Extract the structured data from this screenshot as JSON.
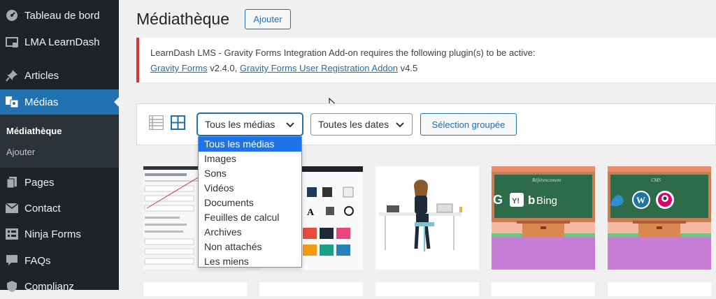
{
  "sidebar": {
    "items": [
      {
        "label": "Tableau de bord",
        "icon": "dashboard-icon"
      },
      {
        "label": "LMA LearnDash",
        "icon": "learndash-icon"
      },
      {
        "label": "Articles",
        "icon": "pin-icon"
      },
      {
        "label": "Médias",
        "icon": "media-icon"
      },
      {
        "label": "Pages",
        "icon": "pages-icon"
      },
      {
        "label": "Contact",
        "icon": "mail-icon"
      },
      {
        "label": "Ninja Forms",
        "icon": "forms-icon"
      },
      {
        "label": "FAQs",
        "icon": "faq-icon"
      },
      {
        "label": "Complianz",
        "icon": "shield-icon"
      }
    ],
    "submenu": [
      {
        "label": "Médiathèque"
      },
      {
        "label": "Ajouter"
      }
    ]
  },
  "header": {
    "title": "Médiathèque",
    "add_label": "Ajouter"
  },
  "notice": {
    "text": "LearnDash LMS - Gravity Forms Integration Add-on requires the following plugin(s) to be active:",
    "link1": "Gravity Forms",
    "ver1": " v2.4.0,",
    "link2": "Gravity Forms User Registration Addon",
    "ver2": " v4.5"
  },
  "toolbar": {
    "type_filter": "Tous les médias",
    "date_filter": "Toutes les dates",
    "bulk_label": "Sélection groupée",
    "options": [
      "Tous les médias",
      "Images",
      "Sons",
      "Vidéos",
      "Documents",
      "Feuilles de calcul",
      "Archives",
      "Non attachés",
      "Les miens"
    ]
  },
  "thumbs": {
    "bing_text": "Bing",
    "board1": "Référencement",
    "board2": "CMS"
  },
  "colors": {
    "accent": "#2271b1",
    "sidebar": "#1d2327",
    "notice_error": "#d63638",
    "selection": "#1e73e8"
  }
}
